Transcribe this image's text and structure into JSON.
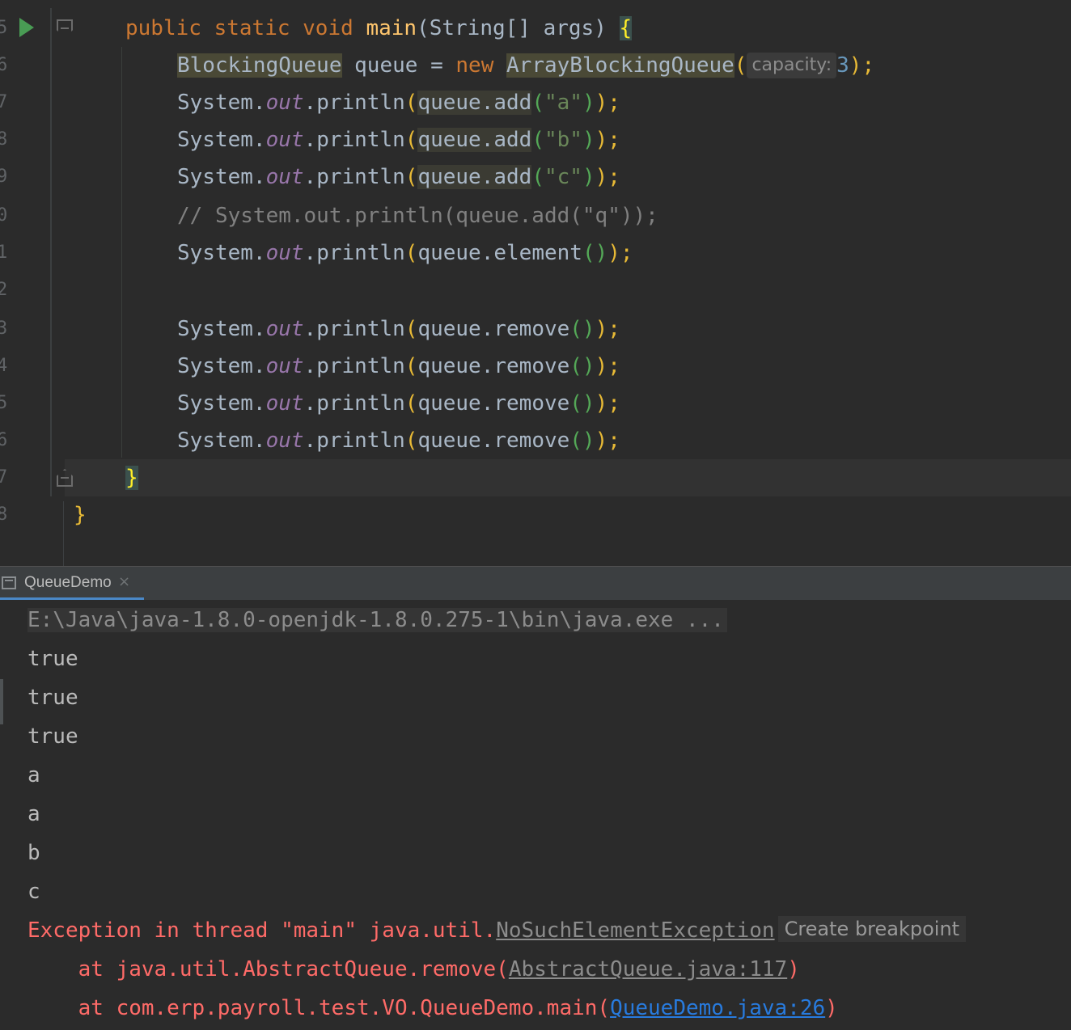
{
  "editor": {
    "line_numbers": [
      "5",
      "6",
      "7",
      "8",
      "9",
      "0",
      "1",
      "2",
      "3",
      "4",
      "5",
      "6",
      "7",
      "8"
    ],
    "lines": {
      "main_sig": {
        "kw1": "public",
        "kw2": "static",
        "kw3": "void",
        "name": "main",
        "params_open": "(String[] args)",
        "brace": "{"
      },
      "decl": {
        "type": "BlockingQueue",
        "var": " queue = ",
        "kw_new": "new",
        "cls": "ArrayBlockingQueue",
        "paren": "(",
        "hint": "capacity:",
        "num": "3",
        "end": ");"
      },
      "add_a": {
        "sys": "System.",
        "out": "out",
        "println": ".println",
        "po": "(",
        "call": "queue.add",
        "pi": "(",
        "arg": "\"a\"",
        "pc": ")",
        "end": ");"
      },
      "add_b": {
        "sys": "System.",
        "out": "out",
        "println": ".println",
        "po": "(",
        "call": "queue.add",
        "pi": "(",
        "arg": "\"b\"",
        "pc": ")",
        "end": ");"
      },
      "add_c": {
        "sys": "System.",
        "out": "out",
        "println": ".println",
        "po": "(",
        "call": "queue.add",
        "pi": "(",
        "arg": "\"c\"",
        "pc": ")",
        "end": ");"
      },
      "comment": "// System.out.println(queue.add(\"q\"));",
      "element": {
        "sys": "System.",
        "out": "out",
        "println": ".println",
        "po": "(",
        "call": "queue.element",
        "pi": "()",
        "end": ");"
      },
      "remove": {
        "sys": "System.",
        "out": "out",
        "println": ".println",
        "po": "(",
        "call": "queue.remove",
        "pi": "()",
        "end": ");"
      },
      "close_method": "}",
      "close_class": "}"
    }
  },
  "run_panel": {
    "tab_label": "QueueDemo",
    "tab_close": "×",
    "command": "E:\\Java\\java-1.8.0-openjdk-1.8.0.275-1\\bin\\java.exe ...",
    "output": [
      "true",
      "true",
      "true",
      "a",
      "a",
      "b",
      "c"
    ],
    "exception": {
      "prefix": "Exception in thread \"main\" java.util.",
      "class_link": "NoSuchElementException",
      "hint": "Create breakpoint",
      "frame1_prefix": "    at java.util.AbstractQueue.remove(",
      "frame1_link": "AbstractQueue.java:117",
      "frame1_suffix": ")",
      "frame2_prefix": "    at com.erp.payroll.test.VO.QueueDemo.main(",
      "frame2_link": "QueueDemo.java:26",
      "frame2_suffix": ")"
    }
  }
}
